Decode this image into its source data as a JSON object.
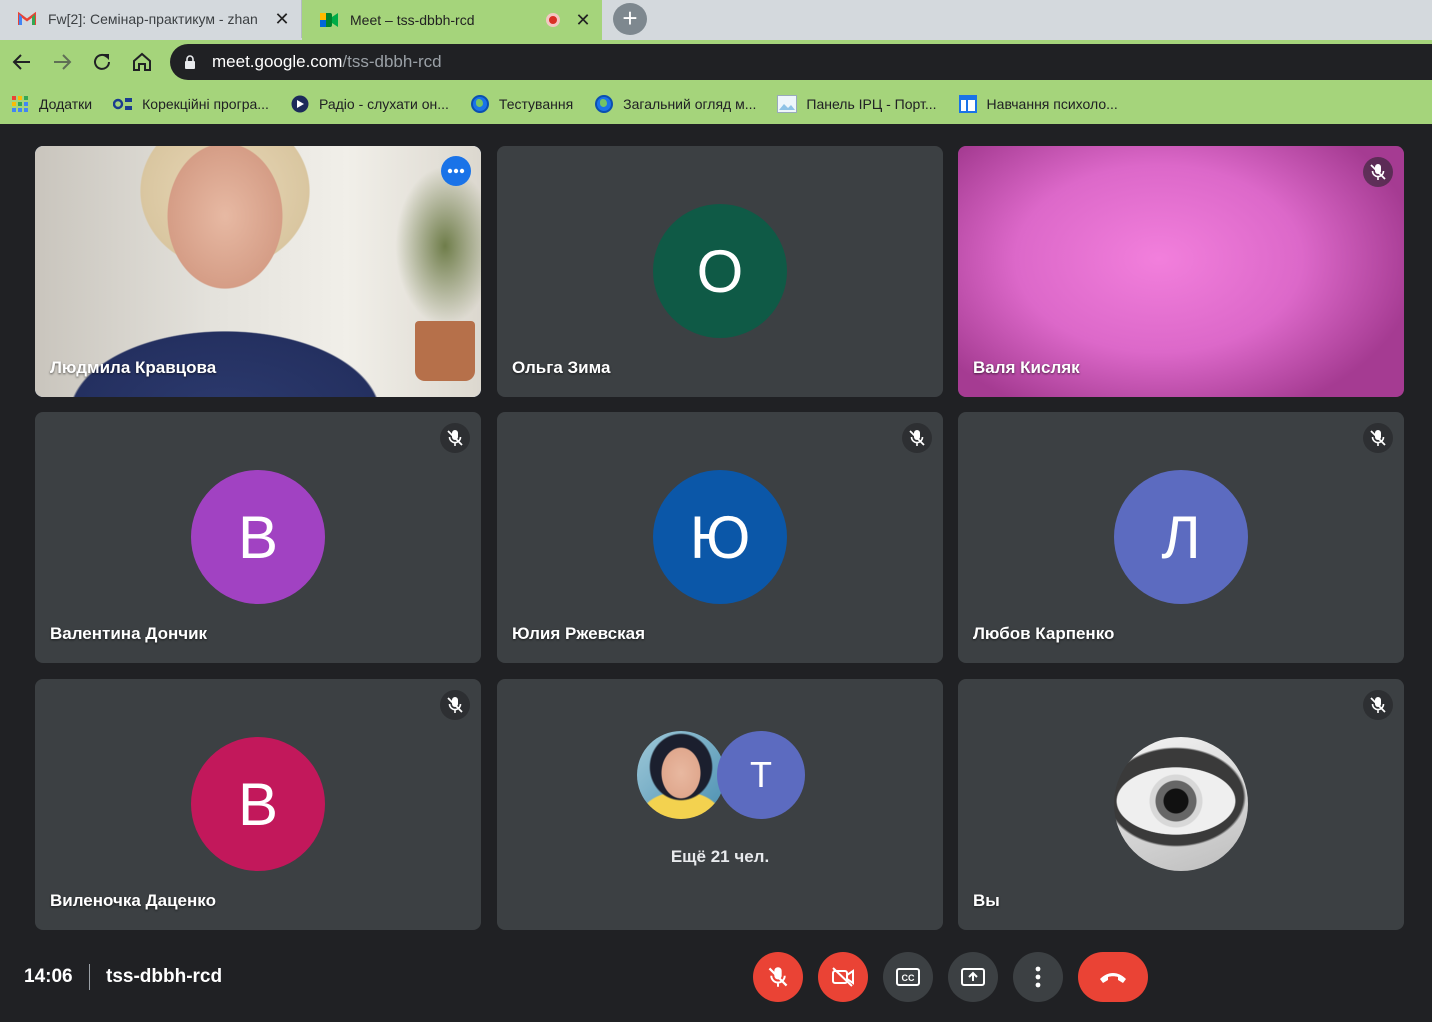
{
  "browser": {
    "tabs": [
      {
        "title": "Fw[2]: Семінар-практикум - zhan",
        "favicon": "gmail-icon",
        "active": false
      },
      {
        "title": "Meet – tss-dbbh-rcd",
        "favicon": "meet-icon",
        "active": true,
        "recording": true
      }
    ],
    "url_host": "meet.google.com",
    "url_path": "/tss-dbbh-rcd",
    "bookmarks": [
      {
        "label": "Додатки",
        "icon": "apps-grid-icon"
      },
      {
        "label": "Корекційні програ...",
        "icon": "cluster-icon"
      },
      {
        "label": "Радіо - слухати он...",
        "icon": "radio-icon"
      },
      {
        "label": "Тестування",
        "icon": "globe-icon"
      },
      {
        "label": "Загальний огляд м...",
        "icon": "globe-icon"
      },
      {
        "label": "Панель IPЦ - Порт...",
        "icon": "image-icon"
      },
      {
        "label": "Навчання психоло...",
        "icon": "calendar-icon"
      }
    ],
    "colors": {
      "chrome": "#a5d47b",
      "inactive_tab": "#d4d9dd"
    }
  },
  "meet": {
    "participants": [
      {
        "name": "Людмила Кравцова",
        "type": "video",
        "speaking": true
      },
      {
        "name": "Ольга Зима",
        "type": "avatar",
        "initial": "О",
        "color": "#0f5a46",
        "muted": false
      },
      {
        "name": "Валя Кисляк",
        "type": "video",
        "muted": true
      },
      {
        "name": "Валентина Дончик",
        "type": "avatar",
        "initial": "В",
        "color": "#a142c2",
        "muted": true
      },
      {
        "name": "Юлия Ржевская",
        "type": "avatar",
        "initial": "Ю",
        "color": "#0b57a8",
        "muted": true
      },
      {
        "name": "Любов Карпенко",
        "type": "avatar",
        "initial": "Л",
        "color": "#5c6bc0",
        "muted": true
      },
      {
        "name": "Виленочка Даценко",
        "type": "avatar",
        "initial": "В",
        "color": "#c2185b",
        "muted": true
      },
      {
        "name": "Вы",
        "type": "photo",
        "muted": true
      }
    ],
    "more": {
      "label": "Ещё 21 чел.",
      "avatar_initial": "Т"
    },
    "bottom": {
      "time": "14:06",
      "code": "tss-dbbh-rcd"
    }
  }
}
